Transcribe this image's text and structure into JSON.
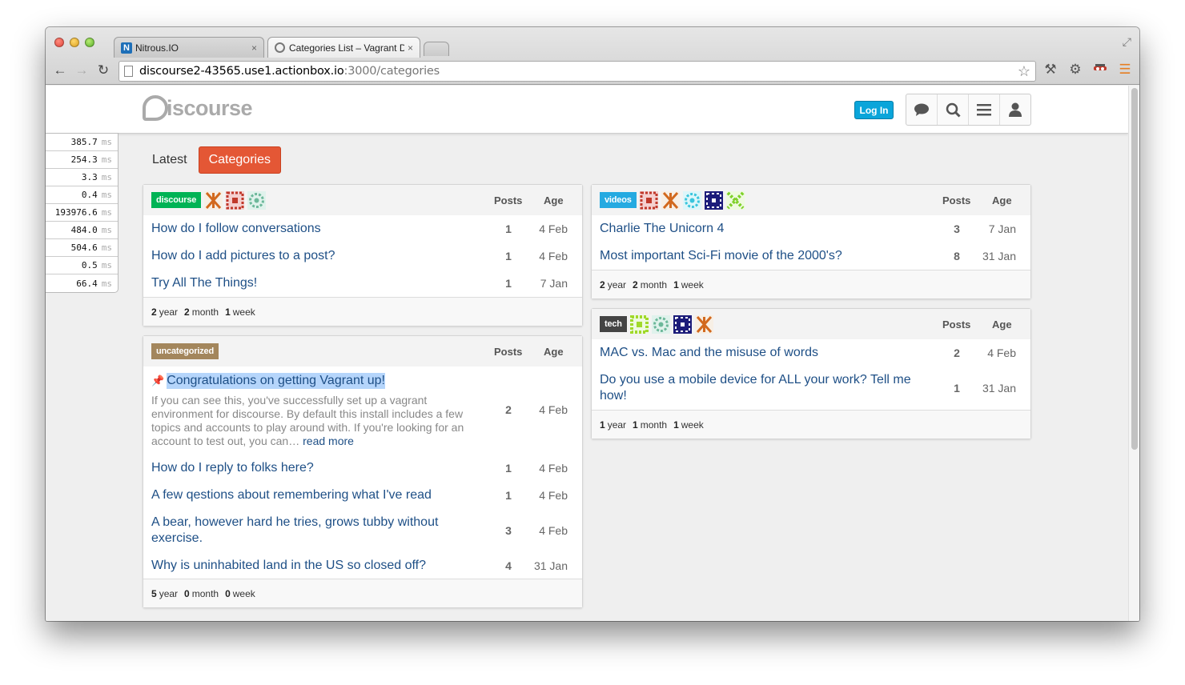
{
  "browser": {
    "tabs": [
      {
        "title": "Nitrous.IO",
        "favicon": "N"
      },
      {
        "title": "Categories List – Vagrant D"
      }
    ],
    "url_host": "discourse2-43565.use1.actionbox.io",
    "url_path": ":3000/categories",
    "close_glyph": "×"
  },
  "header": {
    "logo_text": "iscourse",
    "login_label": "Log In",
    "icons": [
      "chat-bubble-icon",
      "search-icon",
      "hamburger-menu-icon",
      "user-icon"
    ]
  },
  "timings": [
    {
      "value": "385.7",
      "unit": "ms"
    },
    {
      "value": "254.3",
      "unit": "ms"
    },
    {
      "value": "3.3",
      "unit": "ms"
    },
    {
      "value": "0.4",
      "unit": "ms"
    },
    {
      "value": "193976.6",
      "unit": "ms"
    },
    {
      "value": "484.0",
      "unit": "ms"
    },
    {
      "value": "504.6",
      "unit": "ms"
    },
    {
      "value": "0.5",
      "unit": "ms"
    },
    {
      "value": "66.4",
      "unit": "ms"
    }
  ],
  "nav": {
    "latest": "Latest",
    "categories": "Categories"
  },
  "columns": {
    "posts": "Posts",
    "age": "Age"
  },
  "categories": {
    "discourse": {
      "label": "discourse",
      "color": "#00b355",
      "topics": [
        {
          "title": "How do I follow conversations",
          "posts": "1",
          "age": "4 Feb"
        },
        {
          "title": "How do I add pictures to a post?",
          "posts": "1",
          "age": "4 Feb"
        },
        {
          "title": "Try All The Things!",
          "posts": "1",
          "age": "7 Jan"
        }
      ],
      "footer": {
        "years": "2",
        "years_label": "year",
        "months": "2",
        "months_label": "month",
        "weeks": "1",
        "weeks_label": "week"
      }
    },
    "uncategorized": {
      "label": "uncategorized",
      "color": "#a3865c",
      "pinned": {
        "title": "Congratulations on getting Vagrant up!",
        "excerpt": "If you can see this, you've successfully set up a vagrant environment for discourse. By default this install includes a few topics and accounts to play around with. If you're looking for an account to test out, you can…",
        "read_more": "read more",
        "posts": "2",
        "age": "4 Feb"
      },
      "topics": [
        {
          "title": "How do I reply to folks here?",
          "posts": "1",
          "age": "4 Feb"
        },
        {
          "title": "A few qestions about remembering what I've read",
          "posts": "1",
          "age": "4 Feb"
        },
        {
          "title": "A bear, however hard he tries, grows tubby without exercise.",
          "posts": "3",
          "age": "4 Feb"
        },
        {
          "title": "Why is uninhabited land in the US so closed off?",
          "posts": "4",
          "age": "31 Jan"
        }
      ],
      "footer": {
        "years": "5",
        "years_label": "year",
        "months": "0",
        "months_label": "month",
        "weeks": "0",
        "weeks_label": "week"
      }
    },
    "videos": {
      "label": "videos",
      "color": "#25aae1",
      "topics": [
        {
          "title": "Charlie The Unicorn 4",
          "posts": "3",
          "age": "7 Jan"
        },
        {
          "title": "Most important Sci-Fi movie of the 2000's?",
          "posts": "8",
          "age": "31 Jan"
        }
      ],
      "footer": {
        "years": "2",
        "years_label": "year",
        "months": "2",
        "months_label": "month",
        "weeks": "1",
        "weeks_label": "week"
      }
    },
    "tech": {
      "label": "tech",
      "color": "#444444",
      "topics": [
        {
          "title": "MAC vs. Mac and the misuse of words",
          "posts": "2",
          "age": "4 Feb"
        },
        {
          "title": "Do you use a mobile device for ALL your work? Tell me how!",
          "posts": "1",
          "age": "31 Jan"
        }
      ],
      "footer": {
        "years": "1",
        "years_label": "year",
        "months": "1",
        "months_label": "month",
        "weeks": "1",
        "weeks_label": "week"
      }
    }
  }
}
